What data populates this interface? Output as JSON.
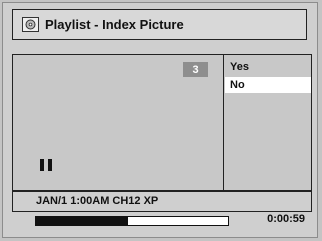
{
  "window": {
    "title": "Playlist - Index Picture"
  },
  "preview": {
    "index_number": "3",
    "playback_state": "pause-icon"
  },
  "options": [
    {
      "label": "Yes",
      "selected": false
    },
    {
      "label": "No",
      "selected": true
    }
  ],
  "info": {
    "recording_details": "JAN/1  1:00AM CH12  XP"
  },
  "status": {
    "progress": 0.48,
    "time": "0:00:59"
  }
}
